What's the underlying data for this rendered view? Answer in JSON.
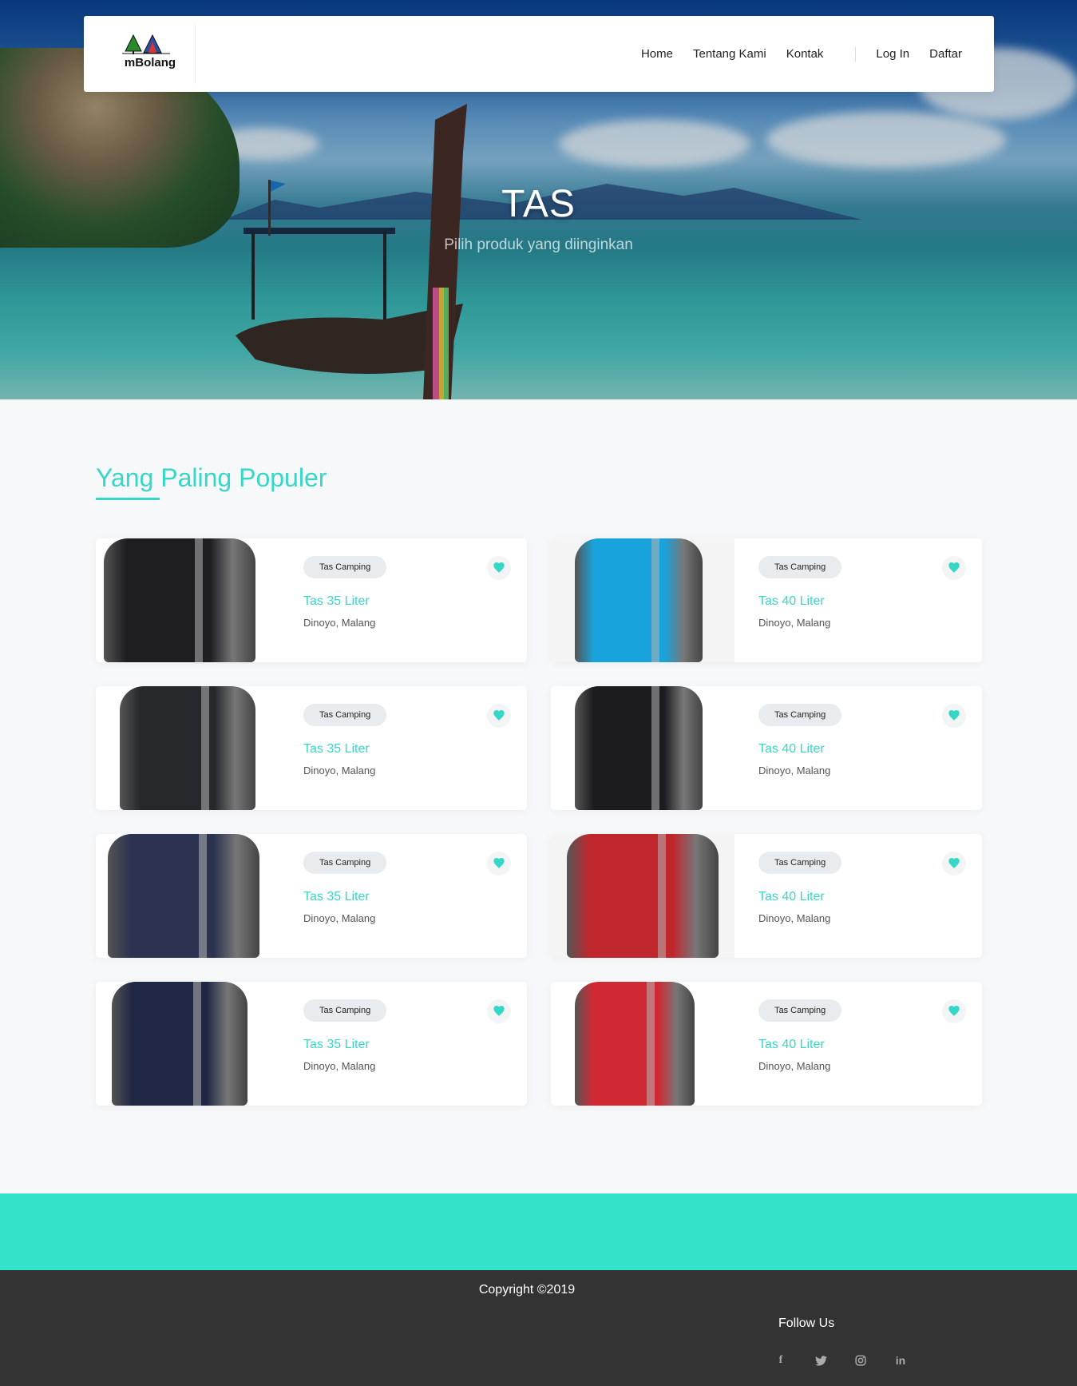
{
  "brand": {
    "name": "mBolang"
  },
  "nav": {
    "items": [
      "Home",
      "Tentang Kami",
      "Kontak"
    ],
    "login": "Log In",
    "register": "Daftar"
  },
  "hero": {
    "title": "TAS",
    "subtitle": "Pilih produk yang diinginkan"
  },
  "section": {
    "title": "Yang Paling Populer"
  },
  "products": [
    {
      "tag": "Tas Camping",
      "title": "Tas 35 Liter",
      "location": "Dinoyo, Malang",
      "color": "#1d1d22"
    },
    {
      "tag": "Tas Camping",
      "title": "Tas 40 Liter",
      "location": "Dinoyo, Malang",
      "color": "#19a3dc"
    },
    {
      "tag": "Tas Camping",
      "title": "Tas 35 Liter",
      "location": "Dinoyo, Malang",
      "color": "#26282b"
    },
    {
      "tag": "Tas Camping",
      "title": "Tas 40 Liter",
      "location": "Dinoyo, Malang",
      "color": "#1c1c20"
    },
    {
      "tag": "Tas Camping",
      "title": "Tas 35 Liter",
      "location": "Dinoyo, Malang",
      "color": "#2b3350"
    },
    {
      "tag": "Tas Camping",
      "title": "Tas 40 Liter",
      "location": "Dinoyo, Malang",
      "color": "#c0272d"
    },
    {
      "tag": "Tas Camping",
      "title": "Tas 35 Liter",
      "location": "Dinoyo, Malang",
      "color": "#1f2744"
    },
    {
      "tag": "Tas Camping",
      "title": "Tas 40 Liter",
      "location": "Dinoyo, Malang",
      "color": "#cf2a33"
    }
  ],
  "footer": {
    "copyright": "Copyright ©2019",
    "follow": "Follow Us",
    "social": [
      "facebook-icon",
      "twitter-icon",
      "instagram-icon",
      "linkedin-icon"
    ]
  },
  "colors": {
    "accent": "#35d8c6",
    "band": "#32e3c9",
    "footer": "#333333"
  }
}
